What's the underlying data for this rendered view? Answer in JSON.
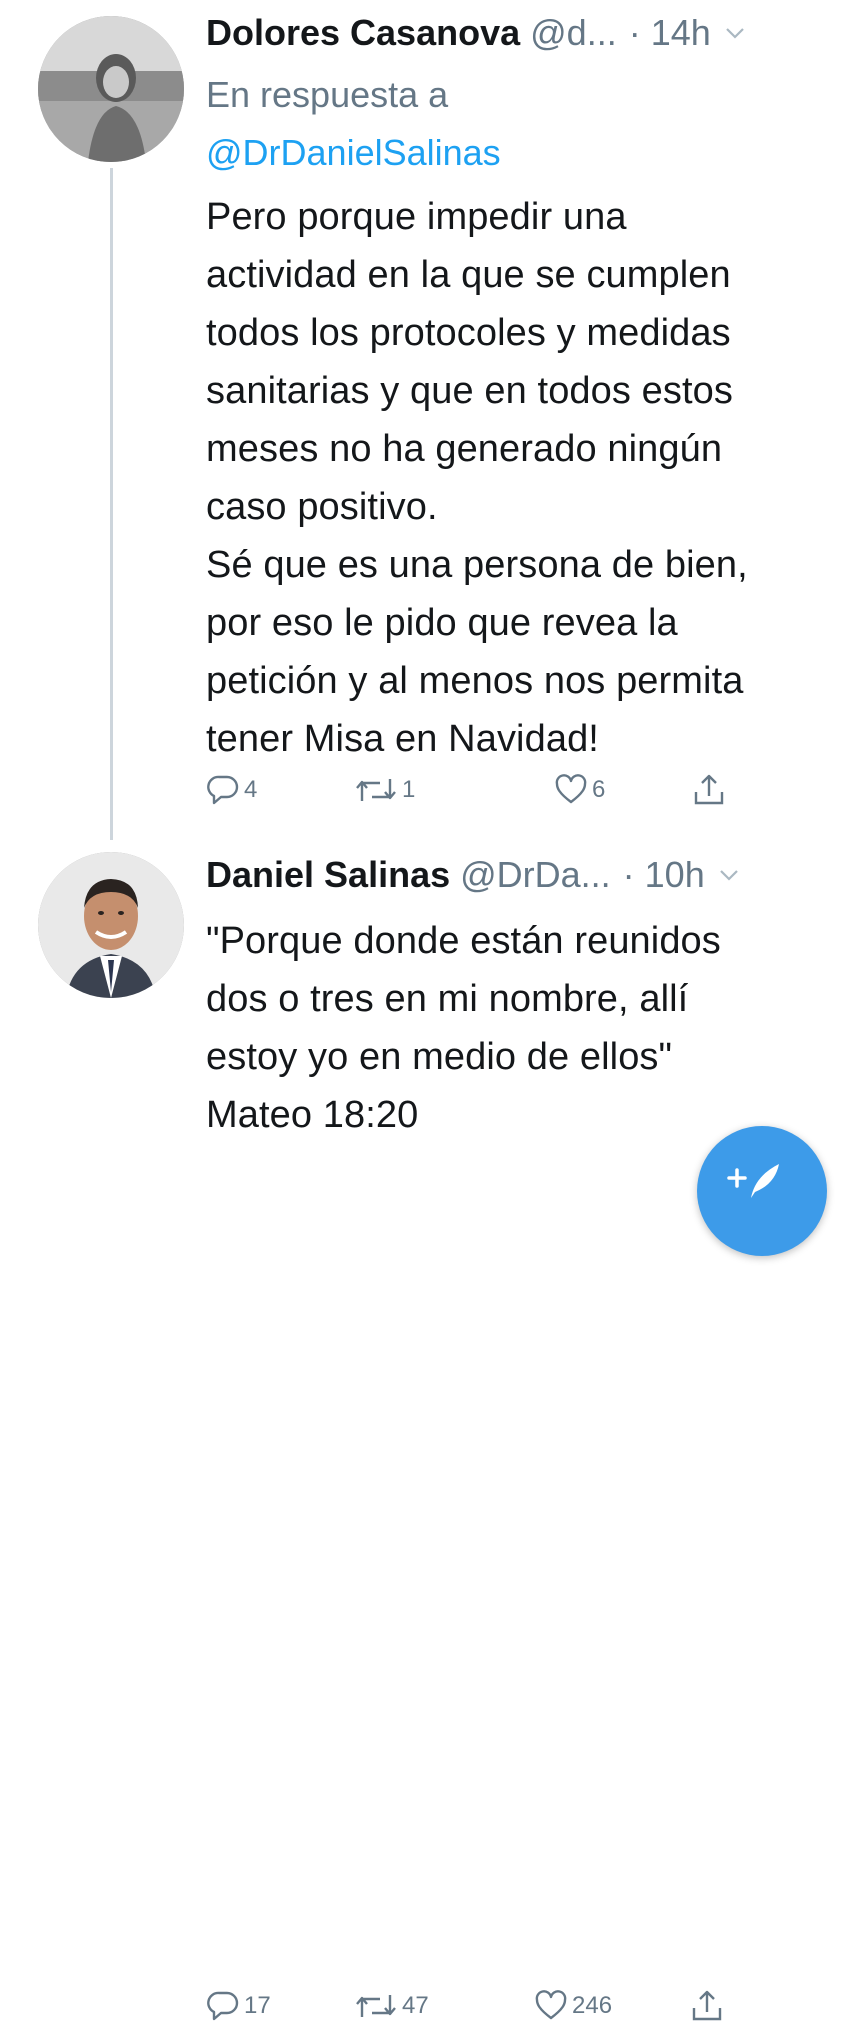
{
  "tweets": [
    {
      "display_name": "Dolores Casanova",
      "handle": "@d...",
      "time": "· 14h",
      "reply_prefix": "En respuesta a",
      "reply_mention": "@DrDanielSalinas",
      "text": "Pero porque impedir una\nactividad en la que se cumplen\ntodos los protocoles y medidas\nsanitarias y que en todos estos\nmeses no ha generado ningún\ncaso positivo.\nSé que es una persona de bien,\npor eso le pido que revea la\npetición y al menos nos permita\ntener Misa en Navidad!",
      "replies": "4",
      "retweets": "1",
      "likes": "6"
    },
    {
      "display_name": "Daniel Salinas",
      "handle": "@DrDa...",
      "time": "· 10h",
      "text": "\"Porque donde están reunidos\ndos o tres en mi nombre, allí\nestoy yo en medio de ellos\"\nMateo 18:20",
      "replies": "17",
      "retweets": "47",
      "likes": "246"
    }
  ],
  "colors": {
    "accent": "#1da1f2",
    "secondary_text": "#657786",
    "fab": "#3d9be9"
  },
  "icons": [
    "reply-icon",
    "retweet-icon",
    "like-icon",
    "share-icon",
    "chevron-down-icon",
    "compose-icon"
  ]
}
